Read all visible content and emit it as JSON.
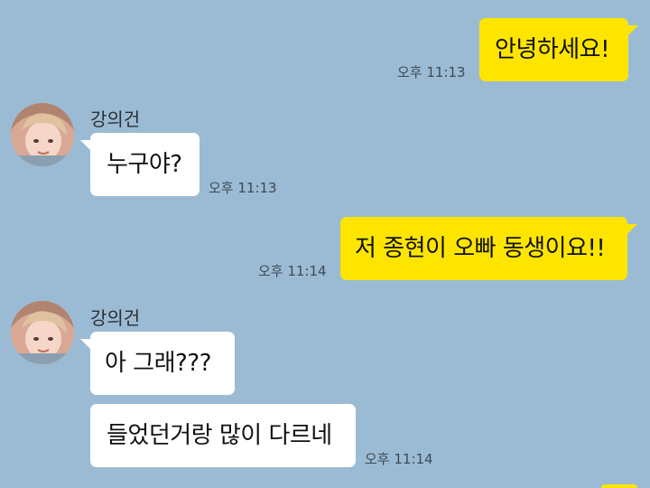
{
  "messages": [
    {
      "id": "m1",
      "sender": "me",
      "text": "안녕하세요!",
      "time": "오후 11:13"
    },
    {
      "id": "m2",
      "sender": "other",
      "name": "강의건",
      "text": "누구야?",
      "time": "오후 11:13"
    },
    {
      "id": "m3",
      "sender": "me",
      "text": "저 종현이 오빠 동생이요!!",
      "time": "오후 11:14"
    },
    {
      "id": "m4",
      "sender": "other",
      "name": "강의건",
      "text": "아 그래???"
    },
    {
      "id": "m5",
      "sender": "other",
      "text": "들었던거랑 많이 다르네",
      "time": "오후 11:14"
    }
  ],
  "colors": {
    "background": "#9bbbd4",
    "my_bubble": "#fee500",
    "other_bubble": "#ffffff"
  },
  "icons": {
    "avatar": "profile-photo"
  }
}
